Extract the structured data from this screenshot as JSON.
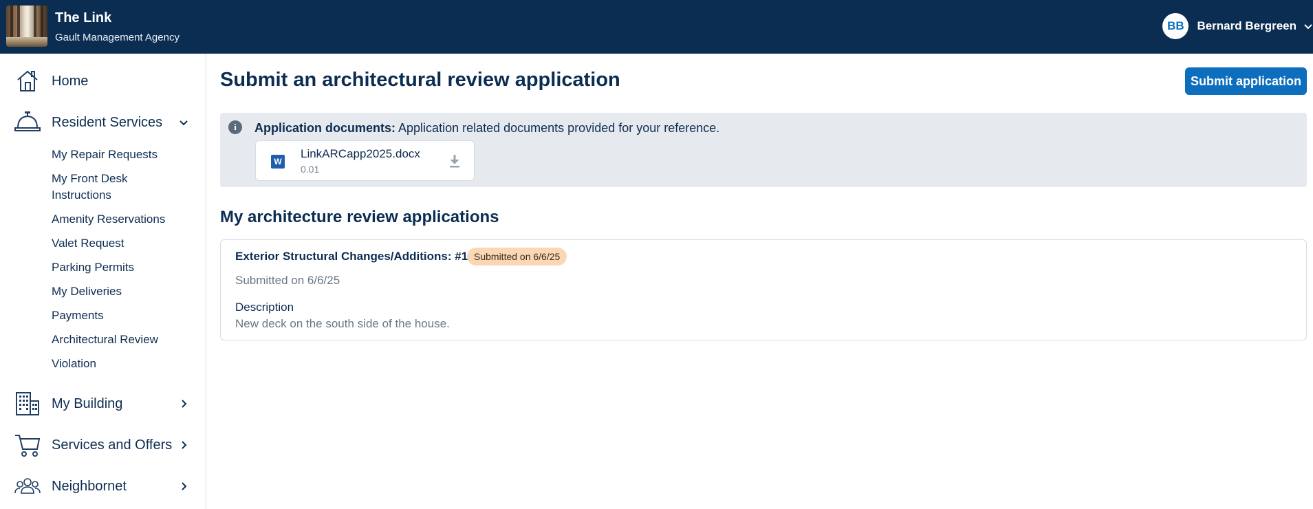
{
  "header": {
    "brand_title": "The Link",
    "brand_subtitle": "Gault Management Agency",
    "user_initials": "BB",
    "user_name": "Bernard Bergreen"
  },
  "sidebar": {
    "home": "Home",
    "resident_services": "Resident Services",
    "sub_items": [
      "My Repair Requests",
      "My Front Desk Instructions",
      "Amenity Reservations",
      "Valet Request",
      "Parking Permits",
      "My Deliveries",
      "Payments",
      "Architectural Review",
      "Violation"
    ],
    "my_building": "My Building",
    "services_offers": "Services and Offers",
    "neighbornet": "Neighbornet"
  },
  "main": {
    "title": "Submit an architectural review application",
    "submit_button": "Submit application",
    "docs": {
      "label": "Application documents:",
      "text": "Application related documents provided for your reference.",
      "file_name": "LinkARCapp2025.docx",
      "file_version": "0.01",
      "file_icon_letter": "W"
    },
    "section_title": "My architecture review applications",
    "applications": [
      {
        "title": "Exterior Structural Changes/Additions: #1",
        "badge": "Submitted on 6/6/25",
        "date": "Submitted on 6/6/25",
        "description_label": "Description",
        "description": "New deck on the south side of the house."
      }
    ]
  },
  "colors": {
    "header_bg": "#0b2d52",
    "primary": "#0d6ebd",
    "badge_bg": "#fbd8b5",
    "panel_bg": "#e6e9ed"
  }
}
